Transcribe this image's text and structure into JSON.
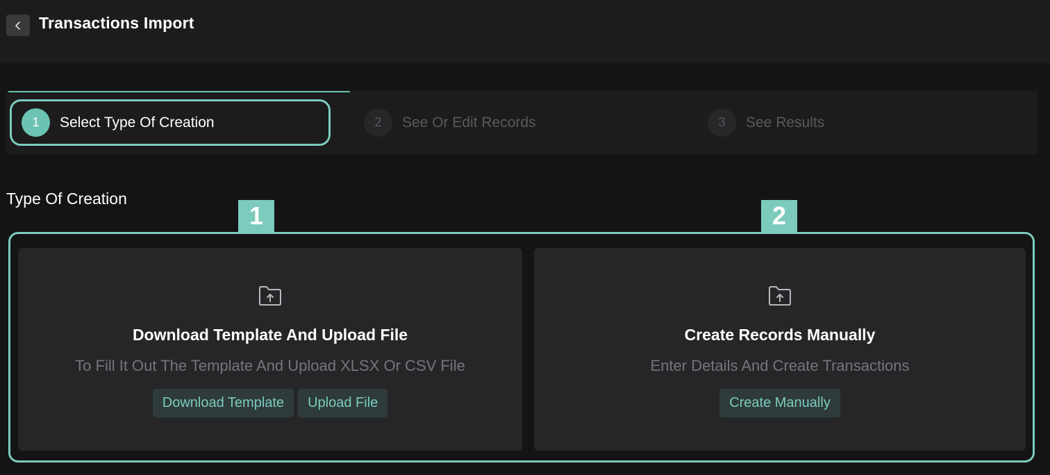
{
  "header": {
    "title": "Transactions Import",
    "back_icon": "chevron-left-icon"
  },
  "stepper": {
    "progress_fraction": 0.333,
    "steps": [
      {
        "number": "1",
        "label": "Select Type Of Creation",
        "state": "active"
      },
      {
        "number": "2",
        "label": "See Or Edit Records",
        "state": "inactive"
      },
      {
        "number": "3",
        "label": "See Results",
        "state": "inactive"
      }
    ]
  },
  "section": {
    "title": "Type Of Creation"
  },
  "markers": [
    "1",
    "2"
  ],
  "cards": [
    {
      "icon": "folder-upload-icon",
      "title": "Download Template And Upload File",
      "description": "To Fill It Out The Template And Upload XLSX Or CSV File",
      "buttons": [
        "Download Template",
        "Upload File"
      ]
    },
    {
      "icon": "folder-upload-icon",
      "title": "Create Records Manually",
      "description": "Enter Details And Create Transactions",
      "buttons": [
        "Create Manually"
      ]
    }
  ],
  "colors": {
    "accent": "#7ccbbd",
    "background": "#141414",
    "panel": "#1c1c1d",
    "card": "#262628",
    "button_bg": "#2e3b3a"
  }
}
